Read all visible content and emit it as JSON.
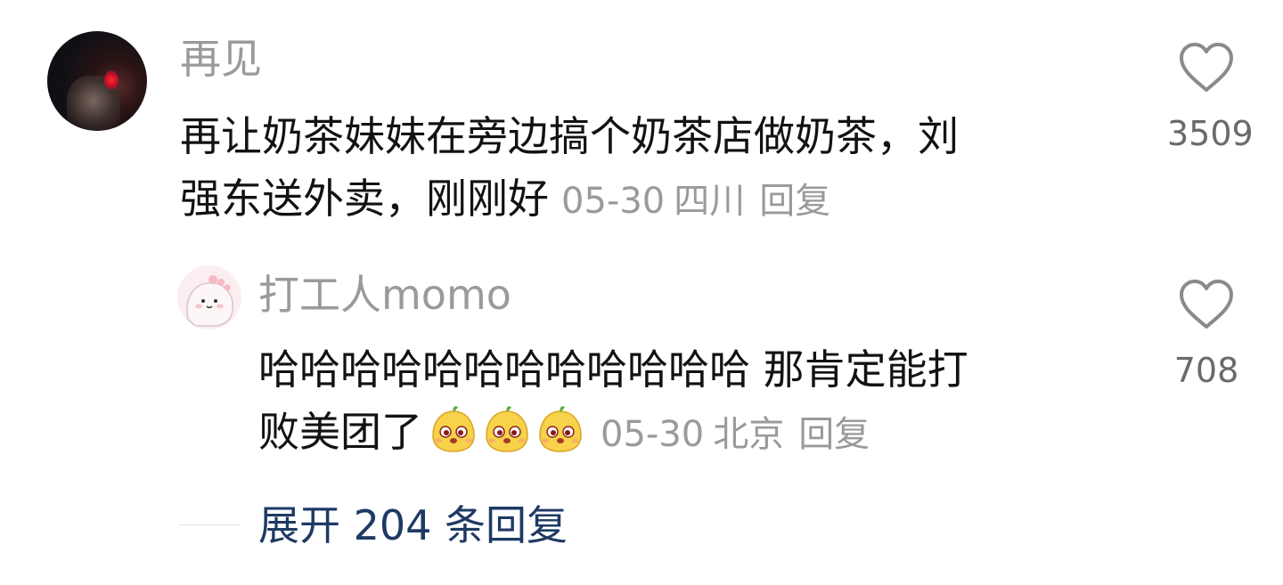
{
  "comment": {
    "author": "再见",
    "text_line1": "再让奶茶妹妹在旁边搞个奶茶店做奶茶，刘",
    "text_line2": "强东送外卖，刚刚好",
    "date": "05-30",
    "location": "四川",
    "reply_label": "回复",
    "likes": "3509",
    "avatar_icon": "photo-avatar-icon"
  },
  "reply": {
    "author": "打工人momo",
    "text_line1": "哈哈哈哈哈哈哈哈哈哈哈哈 那肯定能打",
    "text_line2": "败美团了",
    "emoji_icon": "yellow-blob-emoji-icon",
    "emoji_count": 3,
    "date": "05-30",
    "location": "北京",
    "reply_label": "回复",
    "likes": "708",
    "avatar_icon": "pink-dinosaur-avatar-icon"
  },
  "expand": {
    "label": "展开 204 条回复"
  },
  "colors": {
    "text": "#121212",
    "meta": "#9a9a9a",
    "link": "#1e3a64",
    "heart": "#8a8a8a"
  }
}
